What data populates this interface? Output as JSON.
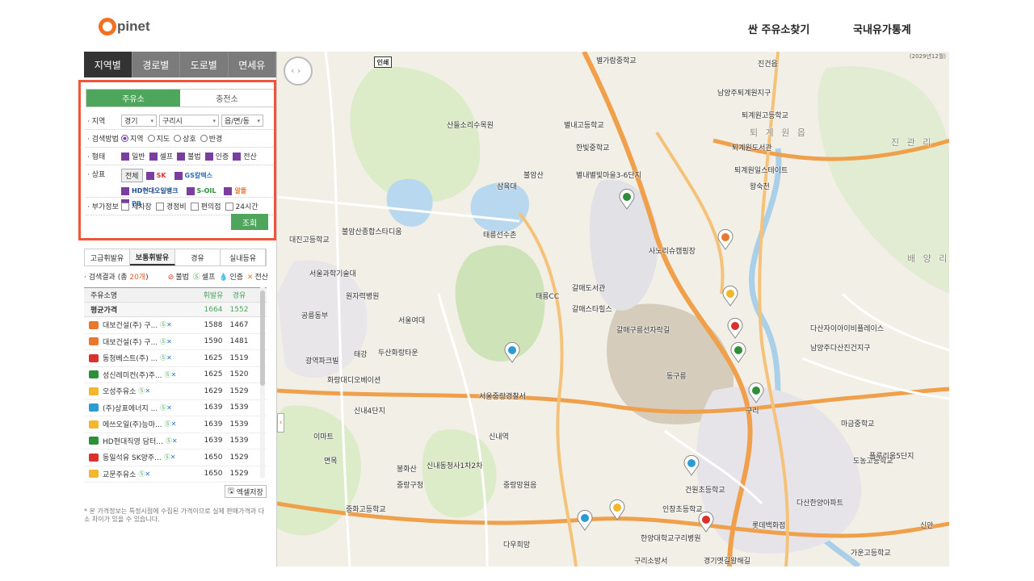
{
  "header": {
    "logo_text": "pinet",
    "nav": [
      "싼 주유소찾기",
      "국내유가통계"
    ]
  },
  "main_tabs": [
    "지역별",
    "경로별",
    "도로별",
    "면세유"
  ],
  "sub_tabs": [
    "주유소",
    "충전소"
  ],
  "filters": {
    "region_label": "지역",
    "region_values": [
      "경기",
      "구리시",
      "읍/면/동"
    ],
    "method_label": "검색방법",
    "methods": [
      "지역",
      "지도",
      "상호",
      "반경"
    ],
    "type_label": "형태",
    "types": [
      "일반",
      "셀프",
      "불법",
      "인증",
      "전산"
    ],
    "brand_label": "상표",
    "all_button": "전체",
    "brands": [
      "SK",
      "GS칼텍스",
      "HD현대오일뱅크",
      "S-OIL",
      "알뜰",
      "PB"
    ],
    "extra_label": "부가정보",
    "extras": [
      "세차장",
      "경정비",
      "편의점",
      "24시간"
    ],
    "search_button": "조회"
  },
  "fuel_tabs": [
    "고급휘발유",
    "보통휘발유",
    "경유",
    "실내등유"
  ],
  "result": {
    "prefix": "· 검색결과 (총 ",
    "count": "20개",
    "suffix": ")",
    "legend": [
      "불법",
      "셀프",
      "인증",
      "전산"
    ]
  },
  "table": {
    "headers": [
      "주유소명",
      "휘발유",
      "경유"
    ],
    "average": {
      "name": "평균가격",
      "gasoline": "1664",
      "diesel": "1552"
    },
    "rows": [
      {
        "name": "대보건설(주) 구...",
        "gasoline": "1588",
        "diesel": "1467",
        "color": "#e8782d"
      },
      {
        "name": "대보건설(주) 구...",
        "gasoline": "1590",
        "diesel": "1481",
        "color": "#e8782d"
      },
      {
        "name": "동청베스트(주) ...",
        "gasoline": "1625",
        "diesel": "1519",
        "color": "#d9322c"
      },
      {
        "name": "성신레미컨(주)주...",
        "gasoline": "1625",
        "diesel": "1520",
        "color": "#2e8f3b"
      },
      {
        "name": "오성주유소",
        "gasoline": "1629",
        "diesel": "1529",
        "color": "#f2b72a"
      },
      {
        "name": "(주)상표에너지 ...",
        "gasoline": "1639",
        "diesel": "1539",
        "color": "#2d9bd2"
      },
      {
        "name": "에쓰오일(주)능마...",
        "gasoline": "1639",
        "diesel": "1539",
        "color": "#f2b72a"
      },
      {
        "name": "HD현대직영 담터...",
        "gasoline": "1639",
        "diesel": "1539",
        "color": "#2e8f3b"
      },
      {
        "name": "동일석유 SK양주...",
        "gasoline": "1650",
        "diesel": "1529",
        "color": "#d9322c"
      },
      {
        "name": "교문주유소",
        "gasoline": "1650",
        "diesel": "1529",
        "color": "#f2b72a"
      }
    ]
  },
  "excel_button": "엑셀저장",
  "note": "* 본 가격정보는 특정시점에 수집된 가격이므로 실제 판매가격과 다소 차이가 있을 수 있습니다.",
  "map": {
    "info_button": "인쇄",
    "copyright": "(2029년12월)",
    "labels": [
      "별가람중학교",
      "남양주퇴계원지구",
      "퇴계원고등학교",
      "퇴 계 원 읍",
      "퇴계원도서관",
      "퇴계원일스테이트",
      "왕숙천",
      "산들소리수목원",
      "별내고등학교",
      "한빛중학교",
      "별내별빛마을3-6단지",
      "삼육대",
      "불암산",
      "태릉선수촌",
      "태릉CC",
      "갈매도서관",
      "갈매스타힐스",
      "사노리슈캠핑장",
      "서울과학기술대",
      "원자력병원",
      "서울여대",
      "불암산종합스타디움",
      "대진고등학교",
      "공릉동부",
      "광역파크빌",
      "태강",
      "두산화랑타운",
      "화랑대디오베이션",
      "신내4단지",
      "동구릉",
      "갈매구릉선자락길",
      "다산자이아이비플레이스",
      "남양주다산진건지구",
      "마금중학교",
      "도농고등학교",
      "플루리움5단지",
      "가운고등학교",
      "다산한양아파트",
      "인창초등학교",
      "건원초등학교",
      "롯데백화점",
      "한양대학교구리병원",
      "구리소방서",
      "경기옛길왕해길",
      "중화고등학교",
      "중랑구청",
      "봉화산",
      "신내동청사1차2차",
      "중랑망원음",
      "다우희망",
      "신내역",
      "이마트",
      "면목",
      "배 양 리",
      "서울중랑경찰서",
      "진 관 리",
      "진건읍",
      "신안",
      "구리"
    ]
  },
  "colors": {
    "accent_green": "#4ea65c",
    "highlight_red": "#f0553a",
    "tab_dark": "#333333",
    "tab_gray": "#7b7b7b",
    "road_orange": "#f0a04b",
    "park_green": "#cfe3b8",
    "water_blue": "#b8d8ef"
  },
  "icons": [
    "search-icon",
    "excel-icon",
    "map-pan-control-icon",
    "gas-station-pin-icon",
    "collapse-arrow-icon"
  ]
}
